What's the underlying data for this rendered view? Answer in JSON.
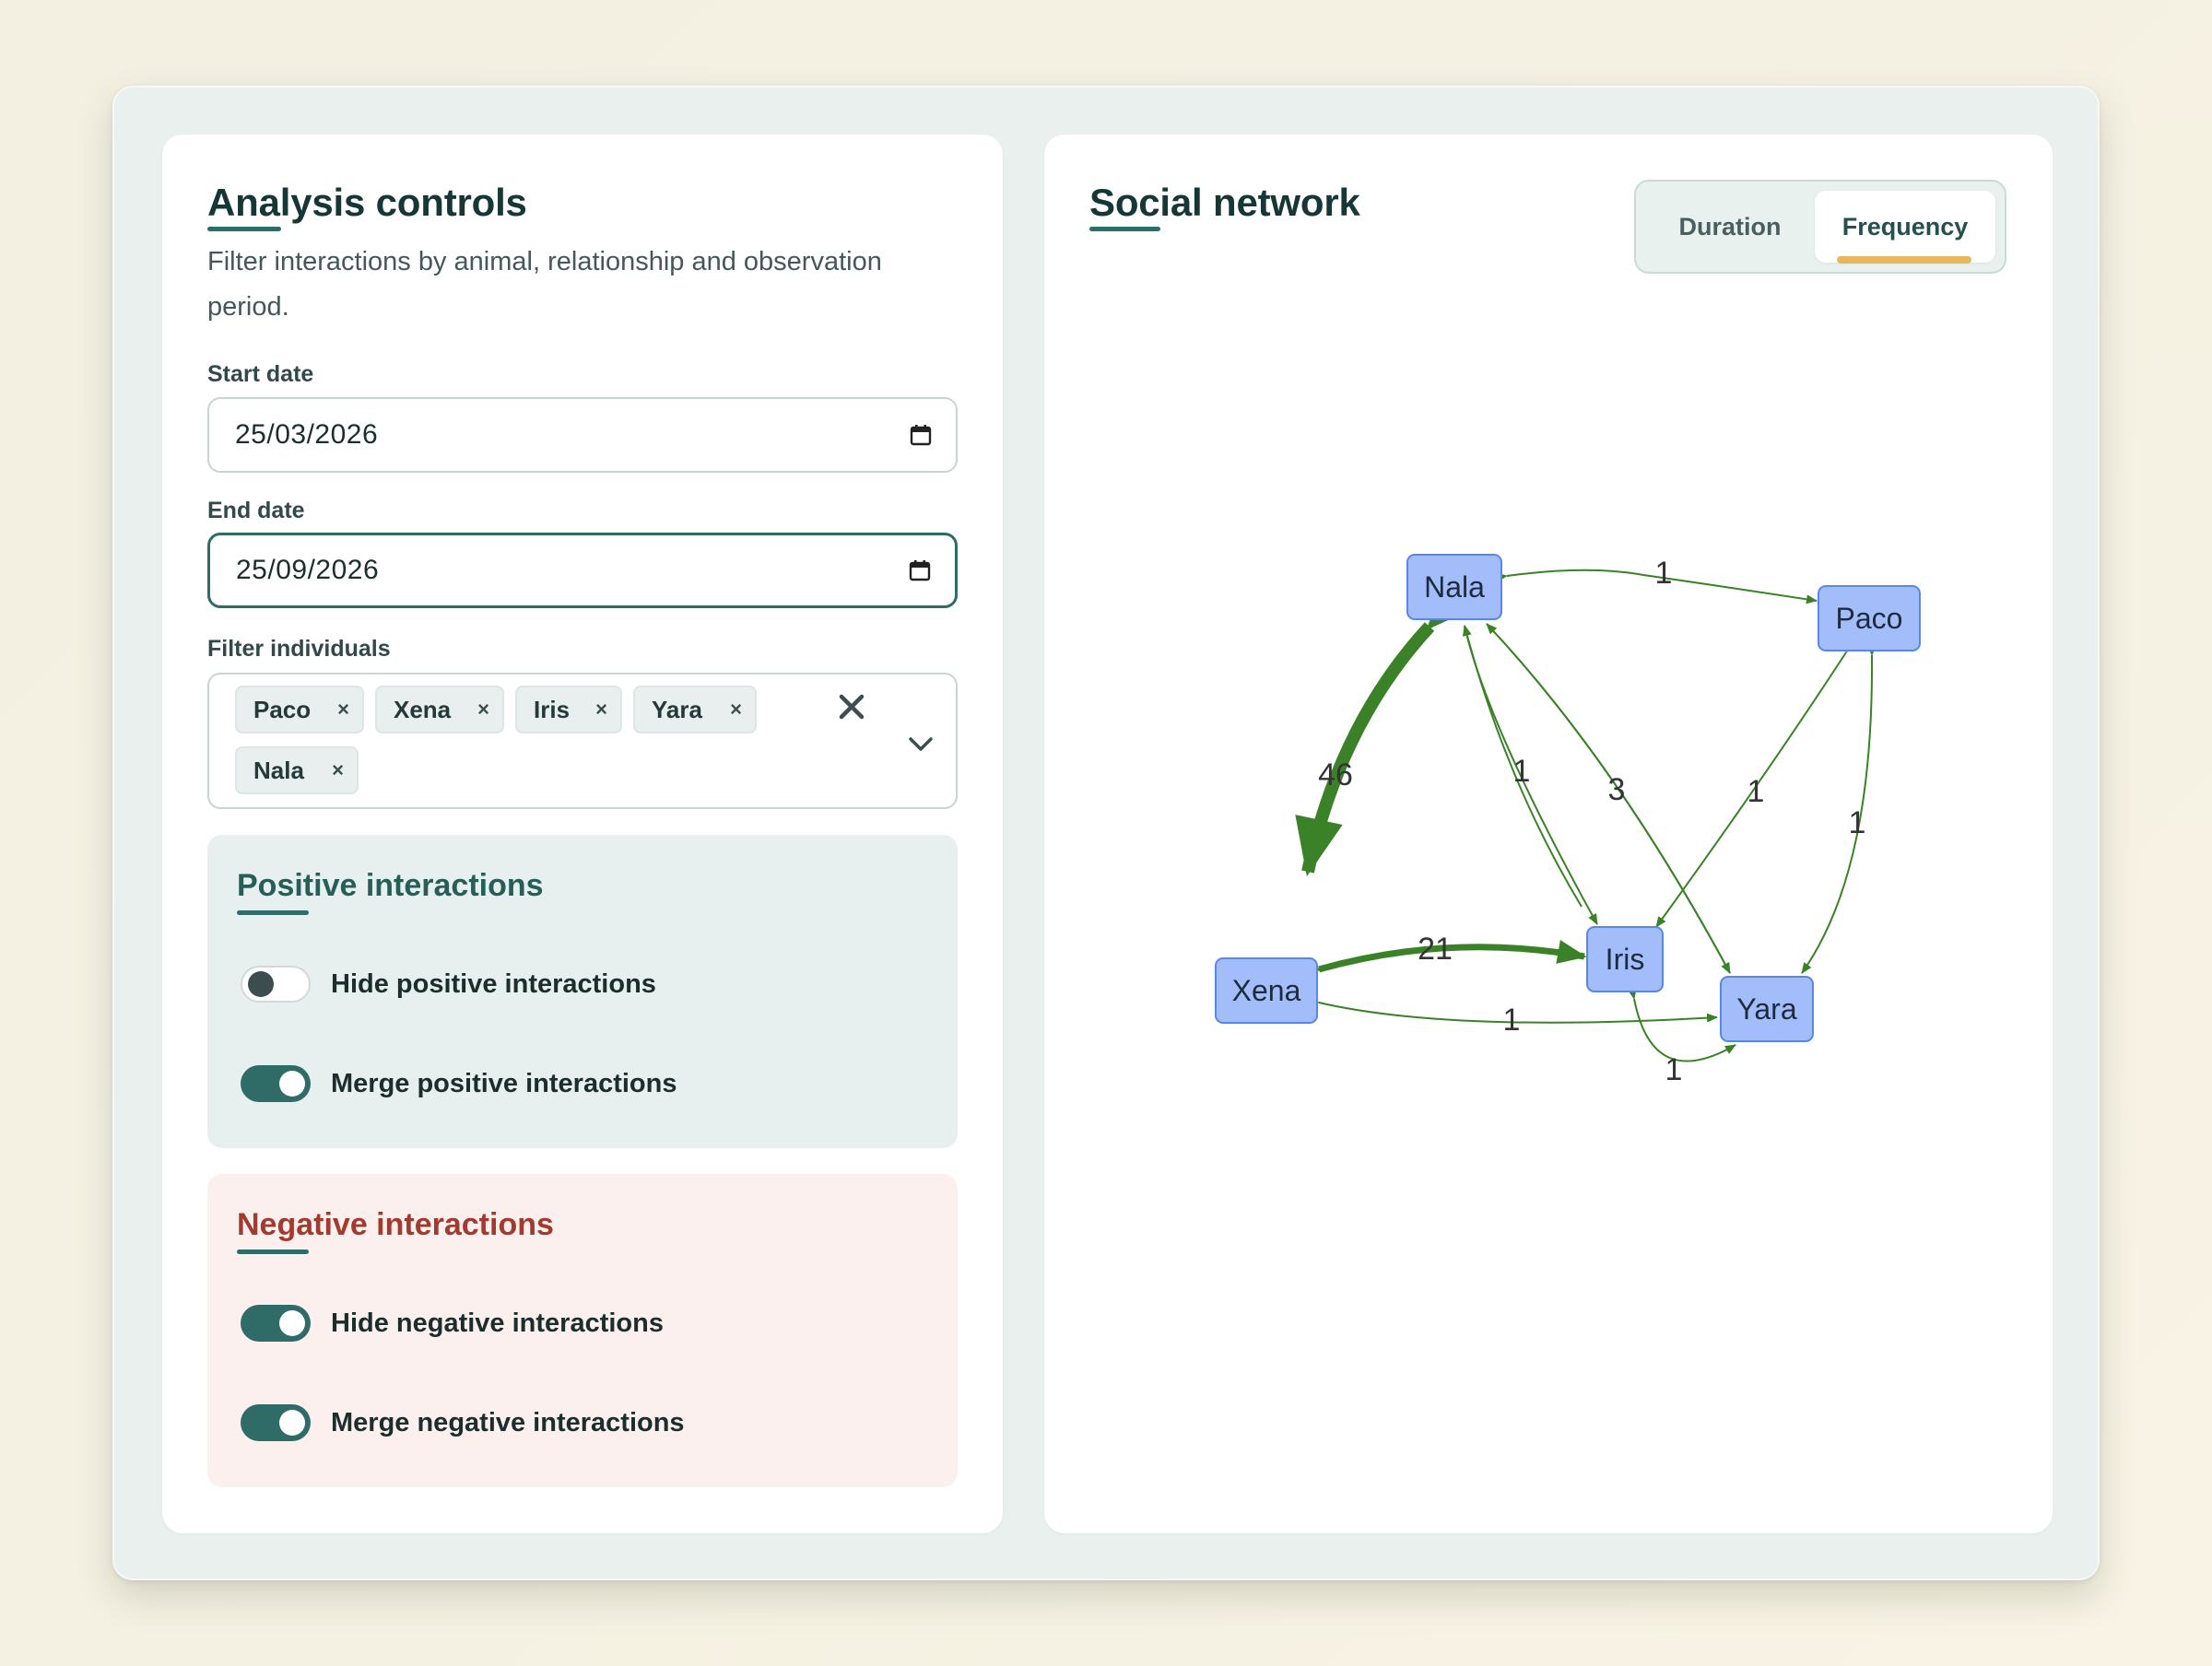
{
  "controls": {
    "title": "Analysis controls",
    "subtitle": "Filter interactions by animal, relationship and observation period.",
    "start_label": "Start date",
    "start_value": "25/03/2026",
    "end_label": "End date",
    "end_value": "25/09/2026",
    "filter_label": "Filter individuals",
    "chips": [
      "Paco",
      "Xena",
      "Iris",
      "Yara",
      "Nala"
    ],
    "chip_remove": "×"
  },
  "positive": {
    "title": "Positive interactions",
    "hide_label": "Hide positive interactions",
    "hide_on": false,
    "merge_label": "Merge positive interactions",
    "merge_on": true
  },
  "negative": {
    "title": "Negative interactions",
    "hide_label": "Hide negative interactions",
    "hide_on": true,
    "merge_label": "Merge negative interactions",
    "merge_on": true
  },
  "network": {
    "title": "Social network",
    "tabs": {
      "duration": "Duration",
      "frequency": "Frequency"
    },
    "active_tab": "Frequency",
    "node_fill": "#a3bdfa",
    "node_stroke": "#5a86e6",
    "edge_color": "#3a8128",
    "nodes": [
      "Nala",
      "Paco",
      "Xena",
      "Iris",
      "Yara"
    ],
    "edges": [
      {
        "from": "Nala",
        "to": "Paco",
        "weight": "1"
      },
      {
        "from": "Nala",
        "to": "Xena",
        "weight": "46"
      },
      {
        "from": "Nala",
        "to": "Iris",
        "weight": "1"
      },
      {
        "from": "Nala",
        "to": "Yara",
        "weight": "3"
      },
      {
        "from": "Paco",
        "to": "Iris",
        "weight": "1"
      },
      {
        "from": "Paco",
        "to": "Yara",
        "weight": "1"
      },
      {
        "from": "Xena",
        "to": "Iris",
        "weight": "21"
      },
      {
        "from": "Xena",
        "to": "Yara",
        "weight": "1"
      },
      {
        "from": "Iris",
        "to": "Yara",
        "weight": "1"
      }
    ]
  }
}
